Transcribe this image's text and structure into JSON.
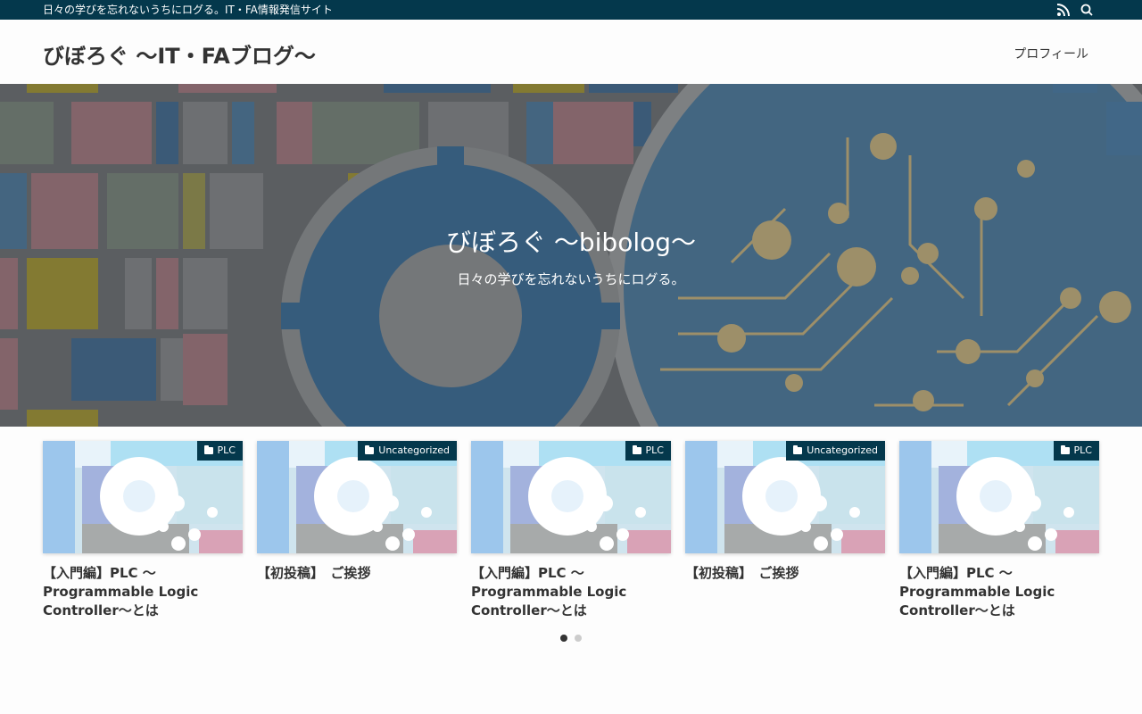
{
  "topbar": {
    "tagline": "日々の学びを忘れないうちにログる。IT・FA情報発信サイト",
    "bg": "#04384c"
  },
  "icons": {
    "rss": "rss-icon",
    "search": "search-icon",
    "category": "folder-icon"
  },
  "header": {
    "site_title": "びぼろぐ 〜IT・FAブログ〜",
    "nav_profile": "プロフィール"
  },
  "hero": {
    "title": "びぼろぐ 〜bibolog〜",
    "subtitle": "日々の学びを忘れないうちにログる。"
  },
  "cards": [
    {
      "category": "PLC",
      "title": "【入門編】PLC ～Programmable Logic Controller～とは"
    },
    {
      "category": "Uncategorized",
      "title": "【初投稿】　ご挨拶"
    },
    {
      "category": "PLC",
      "title": "【入門編】PLC ～Programmable Logic Controller～とは"
    },
    {
      "category": "Uncategorized",
      "title": "【初投稿】　ご挨拶"
    },
    {
      "category": "PLC",
      "title": "【入門編】PLC ～Programmable Logic Controller～とは"
    }
  ],
  "carousel": {
    "pages": 2,
    "active_page": 1
  }
}
